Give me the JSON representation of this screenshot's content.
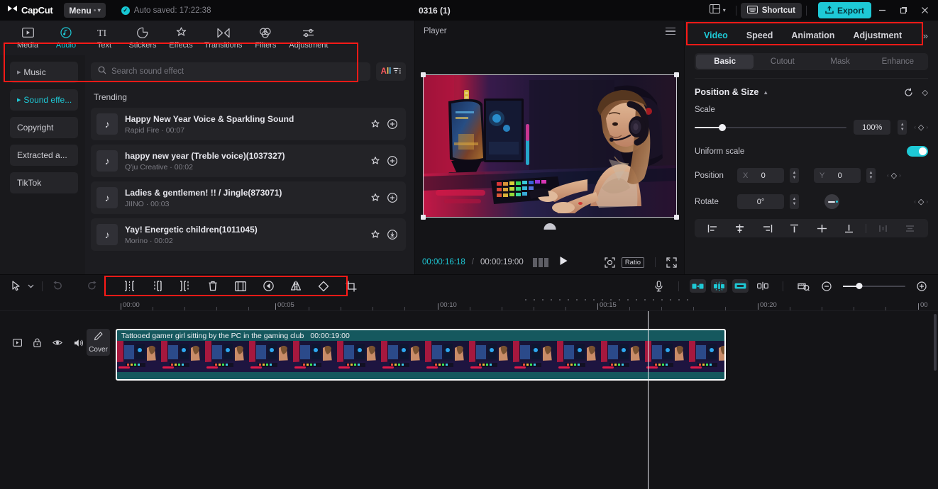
{
  "titlebar": {
    "logo": "CapCut",
    "menu_label": "Menu",
    "autosave": "Auto saved: 17:22:38",
    "project_title": "0316 (1)",
    "shortcut_label": "Shortcut",
    "export_label": "Export",
    "layout_icon": "layout-icon",
    "minimize_icon": "minimize-icon",
    "maximize_icon": "maximize-icon",
    "close_icon": "close-icon",
    "accent": "#1ec9d6"
  },
  "media_tabs": [
    {
      "label": "Media",
      "icon": "media-icon",
      "active": false
    },
    {
      "label": "Audio",
      "icon": "audio-note-icon",
      "active": true
    },
    {
      "label": "Text",
      "icon": "text-icon",
      "active": false
    },
    {
      "label": "Stickers",
      "icon": "sticker-icon",
      "active": false
    },
    {
      "label": "Effects",
      "icon": "effects-sparkle-icon",
      "active": false
    },
    {
      "label": "Transitions",
      "icon": "transitions-icon",
      "active": false
    },
    {
      "label": "Filters",
      "icon": "filters-icon",
      "active": false
    },
    {
      "label": "Adjustment",
      "icon": "adjustment-sliders-icon",
      "active": false
    }
  ],
  "audio_nav": [
    {
      "label": "Music",
      "active": false,
      "expandable": true
    },
    {
      "label": "Sound effe...",
      "active": true,
      "expandable": true
    },
    {
      "label": "Copyright",
      "active": false,
      "expandable": false
    },
    {
      "label": "Extracted a...",
      "active": false,
      "expandable": false
    },
    {
      "label": "TikTok",
      "active": false,
      "expandable": false
    }
  ],
  "search": {
    "placeholder": "Search sound effect",
    "value": "",
    "icon": "search-icon",
    "filter_label": "All",
    "filter_icon": "filter-icon"
  },
  "sfx_section_title": "Trending",
  "sfx_items": [
    {
      "name": "Happy New Year Voice & Sparkling Sound",
      "author": "Rapid Fire",
      "duration": "00:07",
      "sub": "Rapid Fire · 00:07",
      "fav_icon": "star-icon",
      "action_icon": "plus-icon"
    },
    {
      "name": "happy new year (Treble voice)(1037327)",
      "author": "Q'ju Creative",
      "duration": "00:02",
      "sub": "Q'ju Creative · 00:02",
      "fav_icon": "star-icon",
      "action_icon": "plus-icon"
    },
    {
      "name": "Ladies & gentlemen! !! / Jingle(873071)",
      "author": "JIINO",
      "duration": "00:03",
      "sub": "JIINO · 00:03",
      "fav_icon": "star-icon",
      "action_icon": "plus-icon"
    },
    {
      "name": "Yay! Energetic children(1011045)",
      "author": "Morino",
      "duration": "00:02",
      "sub": "Morino · 00:02",
      "fav_icon": "star-icon",
      "action_icon": "download-icon"
    }
  ],
  "player": {
    "title": "Player",
    "menu_icon": "hamburger-icon",
    "current_time": "00:00:16:18",
    "separator": "/",
    "total_time": "00:00:19:00",
    "frames_icon": "frames-icon",
    "play_icon": "play-icon",
    "fit_icon": "fit-screen-icon",
    "ratio_label": "Ratio",
    "fullscreen_icon": "fullscreen-icon"
  },
  "properties": {
    "tabs": [
      {
        "label": "Video",
        "active": true
      },
      {
        "label": "Speed",
        "active": false
      },
      {
        "label": "Animation",
        "active": false
      },
      {
        "label": "Adjustment",
        "active": false
      }
    ],
    "more_icon": "chevron-double-right-icon",
    "subtabs": [
      {
        "label": "Basic",
        "active": true
      },
      {
        "label": "Cutout",
        "active": false
      },
      {
        "label": "Mask",
        "active": false
      },
      {
        "label": "Enhance",
        "active": false
      }
    ],
    "section_title": "Position & Size",
    "reset_icon": "reset-icon",
    "keyframe_icon": "keyframe-diamond-icon",
    "scale_label": "Scale",
    "scale_value": "100%",
    "uniform_scale_label": "Uniform scale",
    "uniform_scale_on": true,
    "position_label": "Position",
    "position_x_axis": "X",
    "position_x_value": "0",
    "position_y_axis": "Y",
    "position_y_value": "0",
    "rotate_label": "Rotate",
    "rotate_value": "0°",
    "align_buttons": [
      {
        "name": "align-left-icon",
        "dim": false
      },
      {
        "name": "align-center-horizontal-icon",
        "dim": false
      },
      {
        "name": "align-right-icon",
        "dim": false
      },
      {
        "name": "align-top-icon",
        "dim": false
      },
      {
        "name": "align-center-vertical-icon",
        "dim": false
      },
      {
        "name": "align-bottom-icon",
        "dim": false
      },
      {
        "name": "distribute-horizontal-icon",
        "dim": true
      },
      {
        "name": "distribute-vertical-icon",
        "dim": true
      }
    ]
  },
  "timeline": {
    "select_icon": "cursor-select-icon",
    "select_caret": "chevron-down-icon",
    "undo_icon": "undo-icon",
    "redo_icon": "redo-icon",
    "edit_tools": [
      "split-icon",
      "delete-left-icon",
      "delete-right-icon",
      "delete-icon",
      "freeze-icon",
      "reverse-icon",
      "mirror-icon",
      "rotate-icon",
      "crop-icon"
    ],
    "mic_icon": "microphone-icon",
    "toggle_tools": [
      "close-gap-icon",
      "auto-snap-icon",
      "link-icon"
    ],
    "adjust_icon": "adjust-track-icon",
    "preview_icon": "preview-track-icon",
    "zoom_out_icon": "zoom-out-icon",
    "zoom_in_icon": "zoom-in-icon",
    "ruler_labels": [
      "00:00",
      "00:05",
      "00:10",
      "00:15",
      "00:20",
      "00"
    ],
    "track_controls": [
      "video-track-icon",
      "lock-icon",
      "eye-icon",
      "volume-icon"
    ],
    "cover_label": "Cover",
    "cover_icon": "pencil-icon",
    "clip": {
      "name": "Tattooed gamer girl sitting by the PC in the gaming club",
      "duration": "00:00:19:00",
      "color": "#15585e"
    },
    "playhead_position": "00:00:16:18"
  }
}
